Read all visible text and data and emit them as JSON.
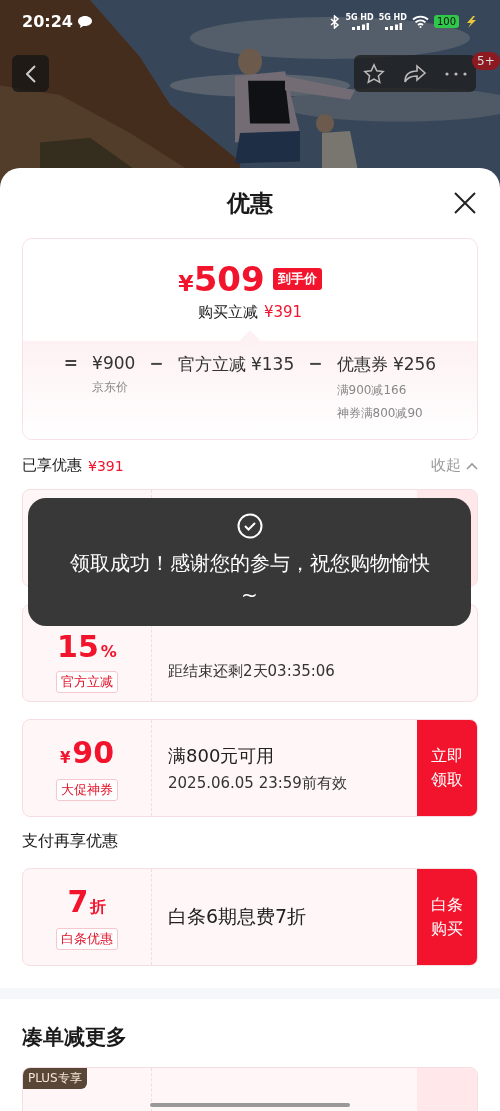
{
  "status_bar": {
    "time": "20:24",
    "network": [
      "5G HD",
      "5G HD"
    ],
    "battery": "100"
  },
  "header": {
    "badge": "5+"
  },
  "sheet": {
    "title": "优惠"
  },
  "summary": {
    "currency": "¥",
    "final_price": "509",
    "price_tag": "到手价",
    "saving_label": "购买立减",
    "saving": "¥391",
    "terms": [
      {
        "op": "=",
        "value": "¥900",
        "notes": [
          "京东价"
        ]
      },
      {
        "op": "−",
        "value": "官方立减 ¥135"
      },
      {
        "op": "−",
        "value": "优惠券 ¥256",
        "notes": [
          "满900减166",
          "神券满800减90"
        ]
      }
    ]
  },
  "enjoyed": {
    "label": "已享优惠",
    "amount": "¥391",
    "toggle": "收起"
  },
  "coupons": [
    {
      "button": {
        "kind": "outline"
      }
    },
    {
      "amount": "15",
      "unit": "%",
      "tag": "官方立减",
      "subtitle": "距结束还剩2天03:35:06"
    },
    {
      "prefix": "¥",
      "amount": "90",
      "tag": "大促神券",
      "title": "满800元可用",
      "subtitle": "2025.06.05 23:59前有效",
      "button": {
        "kind": "primary",
        "label": "立即领取"
      }
    }
  ],
  "pay_section": {
    "title": "支付再享优惠",
    "coupons": [
      {
        "amount": "7",
        "unit": "折",
        "tag": "白条优惠",
        "title": "白条6期息费7折",
        "button": {
          "kind": "primary",
          "label": "白条购买"
        }
      }
    ]
  },
  "more_section": {
    "title": "凑单减更多",
    "coupons": [
      {
        "badge": "PLUS专享",
        "button": {
          "kind": "outline"
        }
      }
    ]
  },
  "toast": {
    "message": "领取成功！感谢您的参与，祝您购物愉快~"
  }
}
